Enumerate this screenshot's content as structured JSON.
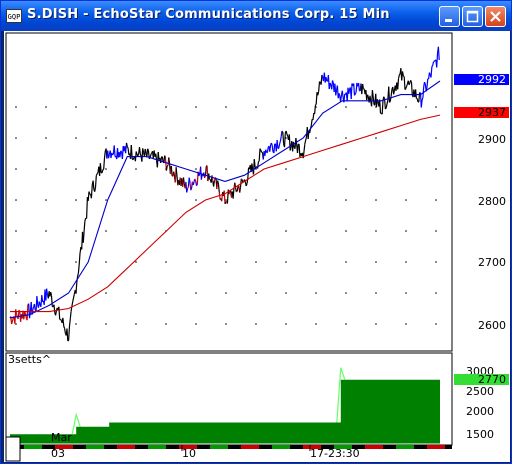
{
  "window": {
    "title": "S.DISH - EchoStar Communications Corp. 15 Min",
    "icon_text": "GQP",
    "buttons": [
      {
        "name": "minimize",
        "icon": "minimize-icon"
      },
      {
        "name": "maximize",
        "icon": "maximize-icon"
      },
      {
        "name": "close",
        "icon": "close-icon"
      }
    ]
  },
  "colors": {
    "price_up": "#0000ff",
    "price_down": "#000000",
    "price_red": "#cc0000",
    "ma_fast": "#0000cc",
    "ma_slow": "#cc0000",
    "indicator_fill": "#008000",
    "indicator_line": "#66ff66",
    "last_price_marker": "#0000ff",
    "ma_marker": "#ff0000",
    "indicator_marker": "#33dd33"
  },
  "price_panel": {
    "y_ticks": [
      "2900",
      "2800",
      "2700",
      "2600"
    ],
    "last_price_label": "2992",
    "ma_label": "2937"
  },
  "indicator_panel": {
    "label": "3setts^",
    "y_ticks": [
      "3000",
      "2500",
      "2000",
      "1500"
    ],
    "value_label": "2770"
  },
  "x_axis": {
    "month_label": "Mar",
    "labels": [
      "03",
      "10",
      "17-23:30"
    ]
  },
  "chart_data": [
    {
      "type": "line",
      "title": "S.DISH - EchoStar Communications Corp. 15 Min",
      "x": [
        "03",
        "10",
        "17-23:30"
      ],
      "ylim": [
        2570,
        3050
      ],
      "series": [
        {
          "values": [
            2610,
            2620,
            2650,
            2580,
            2800,
            2880,
            2880,
            2870,
            2860,
            2820,
            2850,
            2800,
            2830,
            2880,
            2900,
            2880,
            3000,
            2970,
            2980,
            2950,
            3000,
            2960,
            3040
          ]
        },
        {
          "values": [
            2610,
            2615,
            2630,
            2650,
            2700,
            2800,
            2870,
            2870,
            2860,
            2850,
            2840,
            2830,
            2840,
            2860,
            2880,
            2900,
            2940,
            2960,
            2960,
            2960,
            2970,
            2970,
            2992
          ]
        },
        {
          "values": [
            2620,
            2620,
            2620,
            2625,
            2640,
            2660,
            2690,
            2720,
            2750,
            2780,
            2800,
            2810,
            2830,
            2850,
            2860,
            2870,
            2880,
            2890,
            2900,
            2910,
            2920,
            2930,
            2937
          ]
        }
      ]
    },
    {
      "type": "area",
      "title": "3setts^",
      "ylim": [
        1250,
        3150
      ],
      "series": [
        {
          "values": [
            1470,
            1470,
            1650,
            1750,
            1750,
            1750,
            1750,
            1750,
            1750,
            1750,
            2770,
            2770,
            2770,
            2770
          ]
        }
      ]
    }
  ]
}
